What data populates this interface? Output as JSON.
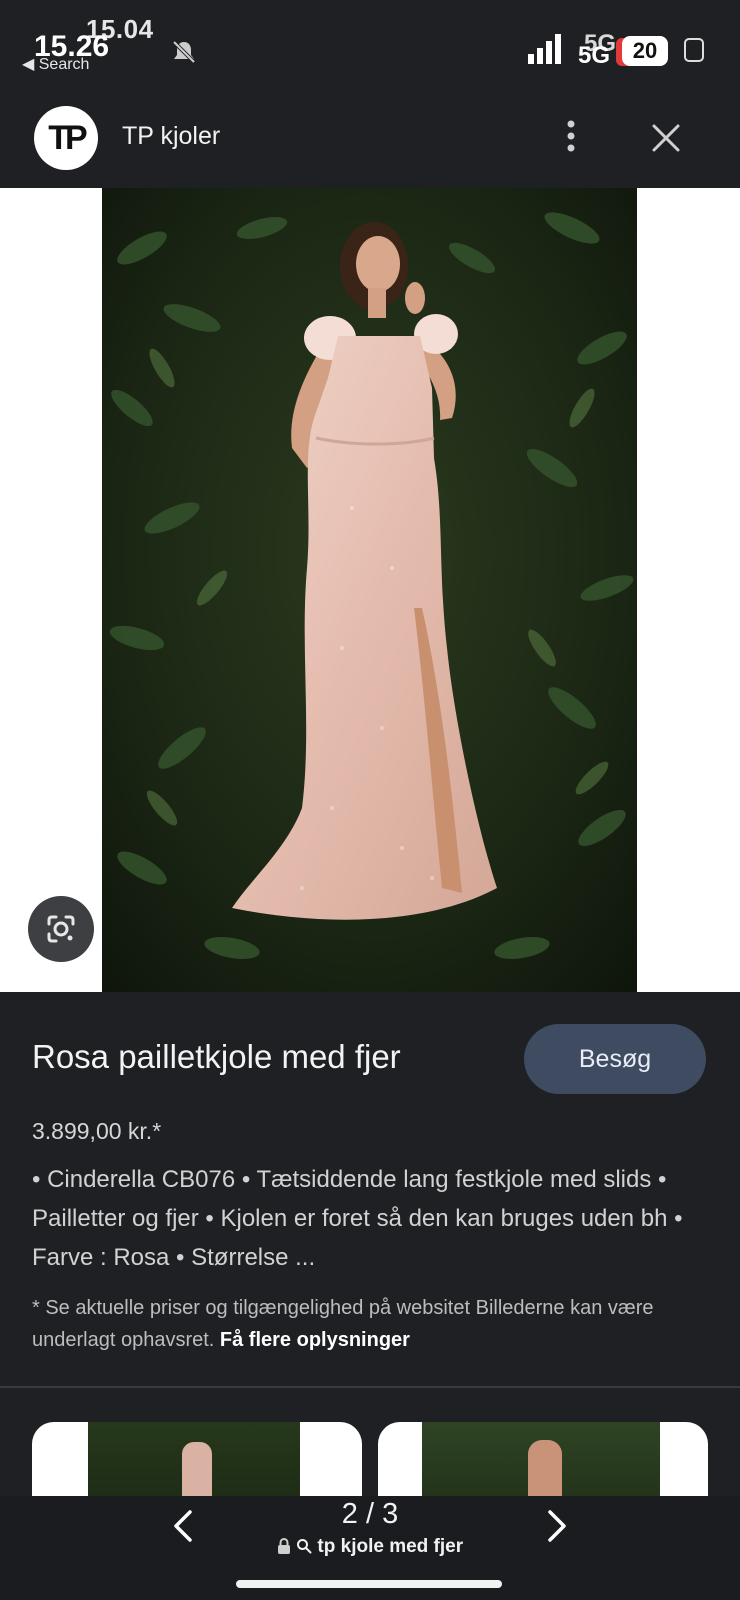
{
  "status_bar": {
    "time_overlay": "15.04",
    "time": "15.26",
    "back_label": "◀ Search",
    "network": "5G",
    "battery": "20"
  },
  "header": {
    "site_logo_text": "TP",
    "site_name": "TP kjoler"
  },
  "product": {
    "title": "Rosa pailletkjole med fjer",
    "visit_label": "Besøg",
    "price": "3.899,00 kr.*",
    "description": "• Cinderella CB076 • Tætsiddende lang festkjole med slids • Pailletter og fjer • Kjolen er foret så den kan bruges uden bh • Farve : Rosa • Størrelse ...",
    "disclaimer": "* Se aktuelle priser og tilgængelighed på websitet Billederne kan være underlagt ophavsret.",
    "more_info_link": "Få flere oplysninger"
  },
  "bottom_bar": {
    "page_counter": "2 / 3",
    "query": "tp kjole med fjer"
  },
  "colors": {
    "background": "#1f2023",
    "visit_button": "#3f4b60",
    "dress_pink": "#e8c3b6",
    "foliage": "#1d2a16"
  },
  "icons": [
    "mute-icon",
    "signal-icon",
    "more-vert-icon",
    "close-icon",
    "google-lens-icon",
    "chevron-left-icon",
    "chevron-right-icon",
    "lock-icon",
    "search-icon"
  ]
}
